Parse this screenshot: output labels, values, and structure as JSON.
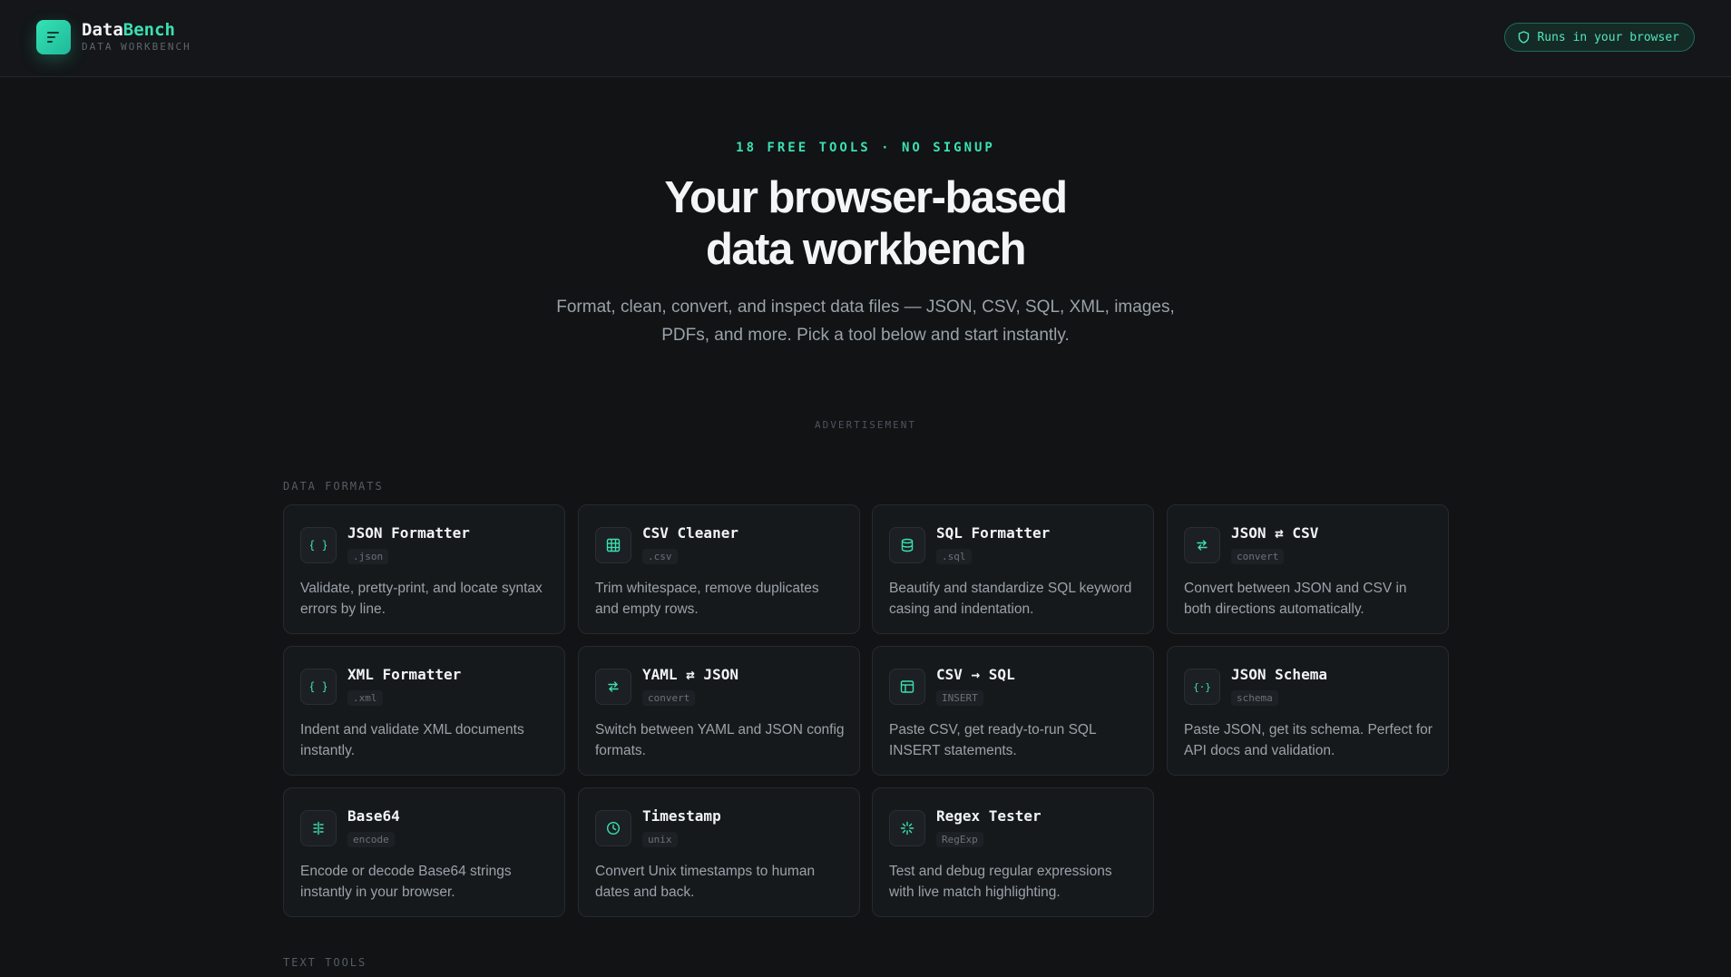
{
  "header": {
    "logo_name_a": "Data",
    "logo_name_b": "Bench",
    "logo_sub": "DATA WORKBENCH",
    "badge": "Runs in your browser"
  },
  "hero": {
    "eyebrow": "18 FREE TOOLS · NO SIGNUP",
    "title_line1": "Your browser-based",
    "title_line2": "data workbench",
    "subtitle": "Format, clean, convert, and inspect data files — JSON, CSV, SQL, XML, images, PDFs, and more. Pick a tool below and start instantly."
  },
  "ad_label": "ADVERTISEMENT",
  "sections": {
    "data_formats": "DATA FORMATS",
    "text_tools": "TEXT TOOLS"
  },
  "tools": [
    {
      "title": "JSON Formatter",
      "tag": ".json",
      "desc": "Validate, pretty-print, and locate syntax errors by line.",
      "icon": "braces-icon"
    },
    {
      "title": "CSV Cleaner",
      "tag": ".csv",
      "desc": "Trim whitespace, remove duplicates and empty rows.",
      "icon": "grid-icon"
    },
    {
      "title": "SQL Formatter",
      "tag": ".sql",
      "desc": "Beautify and standardize SQL keyword casing and indentation.",
      "icon": "database-icon"
    },
    {
      "title": "JSON ⇄ CSV",
      "tag": "convert",
      "desc": "Convert between JSON and CSV in both directions automatically.",
      "icon": "swap-icon"
    },
    {
      "title": "XML Formatter",
      "tag": ".xml",
      "desc": "Indent and validate XML documents instantly.",
      "icon": "braces-icon"
    },
    {
      "title": "YAML ⇄ JSON",
      "tag": "convert",
      "desc": "Switch between YAML and JSON config formats.",
      "icon": "swap-icon"
    },
    {
      "title": "CSV → SQL",
      "tag": "INSERT",
      "desc": "Paste CSV, get ready-to-run SQL INSERT statements.",
      "icon": "table-icon"
    },
    {
      "title": "JSON Schema",
      "tag": "schema",
      "desc": "Paste JSON, get its schema. Perfect for API docs and validation.",
      "icon": "schema-icon"
    },
    {
      "title": "Base64",
      "tag": "encode",
      "desc": "Encode or decode Base64 strings instantly in your browser.",
      "icon": "binary-icon"
    },
    {
      "title": "Timestamp",
      "tag": "unix",
      "desc": "Convert Unix timestamps to human dates and back.",
      "icon": "clock-icon"
    },
    {
      "title": "Regex Tester",
      "tag": "RegExp",
      "desc": "Test and debug regular expressions with live match highlighting.",
      "icon": "sparkle-icon"
    }
  ],
  "colors": {
    "accent": "#3be0b3",
    "background": "#111315",
    "card": "#16191c"
  }
}
